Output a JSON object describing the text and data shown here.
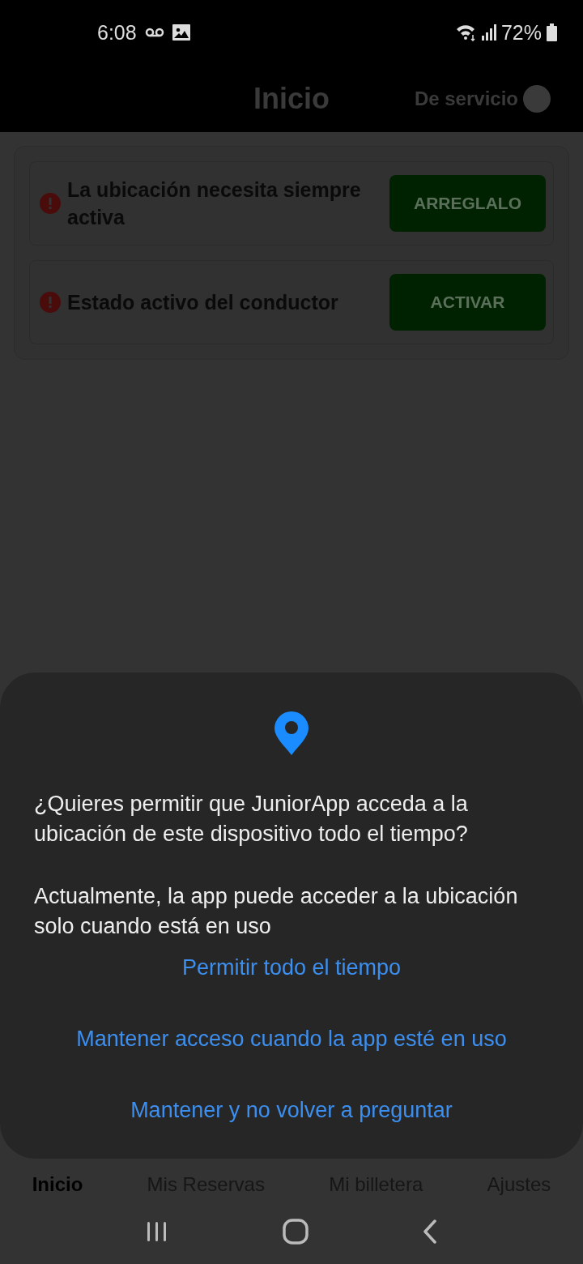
{
  "status_bar": {
    "time": "6:08",
    "battery": "72%"
  },
  "header": {
    "title": "Inicio",
    "duty_label": "De servicio",
    "duty_on": false
  },
  "alerts": [
    {
      "text": "La ubicación necesita siempre activa",
      "action": "ARREGLALO"
    },
    {
      "text": "Estado activo del conductor",
      "action": "ACTIVAR"
    }
  ],
  "tabs": [
    {
      "label": "Inicio",
      "selected": true
    },
    {
      "label": "Mis Reservas",
      "selected": false
    },
    {
      "label": "Mi billetera",
      "selected": false
    },
    {
      "label": "Ajustes",
      "selected": false
    }
  ],
  "dialog": {
    "question": "¿Quieres permitir que JuniorApp acceda a la ubicación de este dispositivo todo el tiempo?",
    "note": "Actualmente, la app puede acceder a la ubicación solo cuando está en uso",
    "options": [
      "Permitir todo el tiempo",
      "Mantener acceso cuando la app esté en uso",
      "Mantener y no volver a preguntar"
    ]
  }
}
